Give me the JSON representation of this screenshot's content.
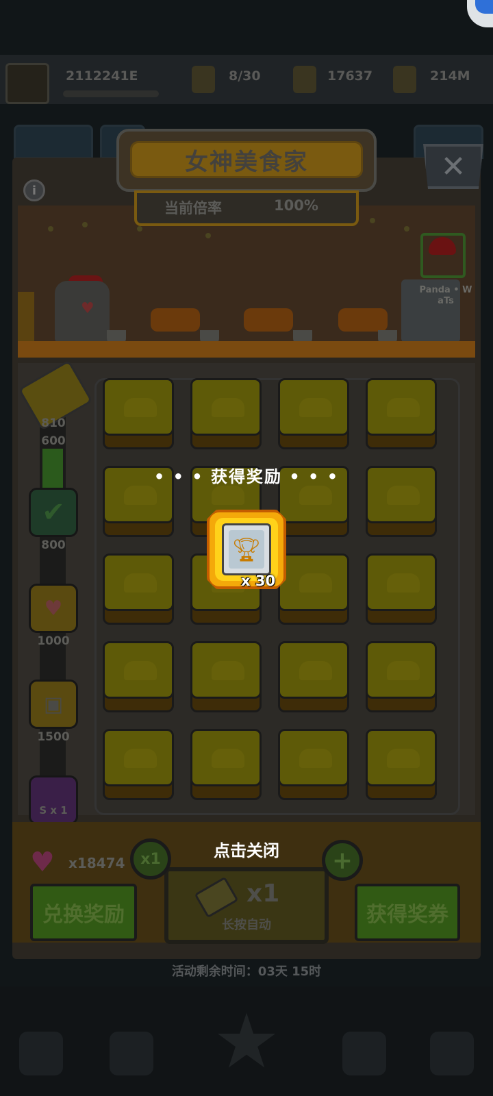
{
  "colors": {
    "overlay_bg": "#111618",
    "reward_gold": "#f4a90a",
    "reward_text": "#ffffff"
  },
  "resources": {
    "player_id": "2112241E",
    "energy": "8/30",
    "currency1": "17637",
    "currency2": "214M"
  },
  "event": {
    "title": "女神美食家",
    "rate_label": "当前倍率",
    "rate_value": "100%",
    "npc_name": "Panda • W aTs"
  },
  "rail": {
    "labels": [
      "810",
      "600",
      "800",
      "1000",
      "1500"
    ],
    "purple_label": "S x 1"
  },
  "grid": {
    "rows": 5,
    "cols": 4
  },
  "bottom": {
    "hearts_count": "x18474",
    "mult_badge": "x1",
    "exchange_label": "兑换奖励",
    "draw_mult": "x1",
    "draw_hint": "长按自动",
    "get_ticket_label": "获得奖券",
    "plus": "+",
    "timer": "活动剩余时间：03天 15时"
  },
  "icons": {
    "close": "close-icon",
    "info": "info-icon",
    "heart": "heart-icon",
    "check": "check-icon",
    "ticket": "ticket-icon",
    "trophy": "trophy-icon"
  },
  "reward_popup": {
    "title": "• • •  获得奖励  • • •",
    "item_qty": "x 30",
    "tap_to_close": "点击关闭"
  }
}
